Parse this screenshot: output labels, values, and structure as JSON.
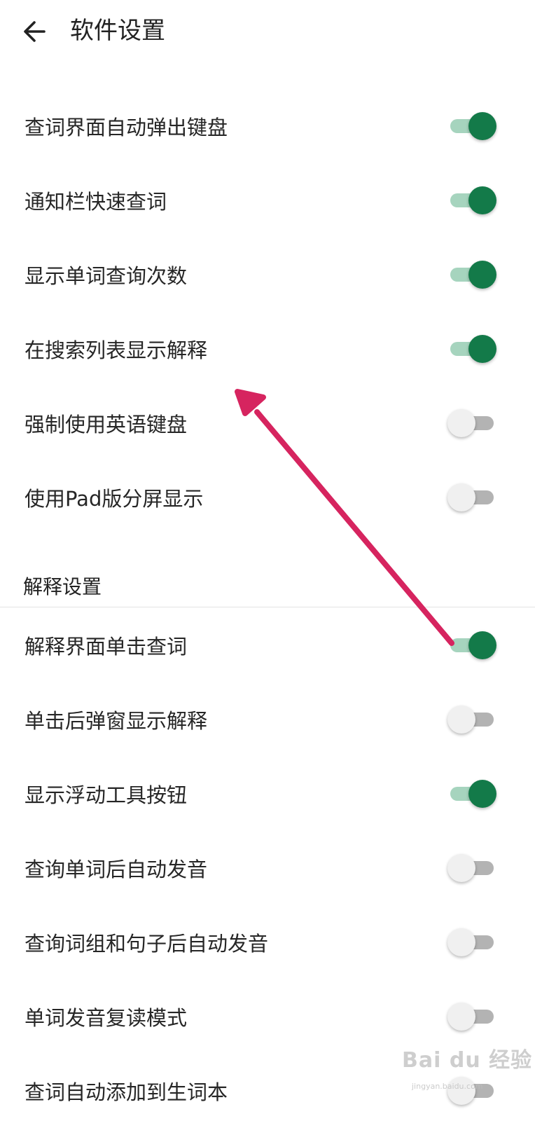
{
  "header": {
    "title": "软件设置"
  },
  "settings": [
    {
      "label": "查词界面自动弹出键盘",
      "on": true
    },
    {
      "label": "通知栏快速查词",
      "on": true
    },
    {
      "label": "显示单词查询次数",
      "on": true
    },
    {
      "label": "在搜索列表显示解释",
      "on": true
    },
    {
      "label": "强制使用英语键盘",
      "on": false
    },
    {
      "label": "使用Pad版分屏显示",
      "on": false
    }
  ],
  "section": {
    "title": "解释设置"
  },
  "explain_settings": [
    {
      "label": "解释界面单击查词",
      "on": true
    },
    {
      "label": "单击后弹窗显示解释",
      "on": false
    },
    {
      "label": "显示浮动工具按钮",
      "on": true
    },
    {
      "label": "查询单词后自动发音",
      "on": false
    },
    {
      "label": "查询词组和句子后自动发音",
      "on": false
    },
    {
      "label": "单词发音复读模式",
      "on": false
    },
    {
      "label": "查词自动添加到生词本",
      "on": false
    }
  ],
  "colors": {
    "switch_on_thumb": "#137a49",
    "switch_on_track": "#a6d4be",
    "switch_off_thumb": "#f0f0f0",
    "switch_off_track": "#b3b3b3",
    "annotation_arrow": "#d6245f"
  },
  "watermark": {
    "logo": "Bai du 经验",
    "url": "jingyan.baidu.com"
  }
}
